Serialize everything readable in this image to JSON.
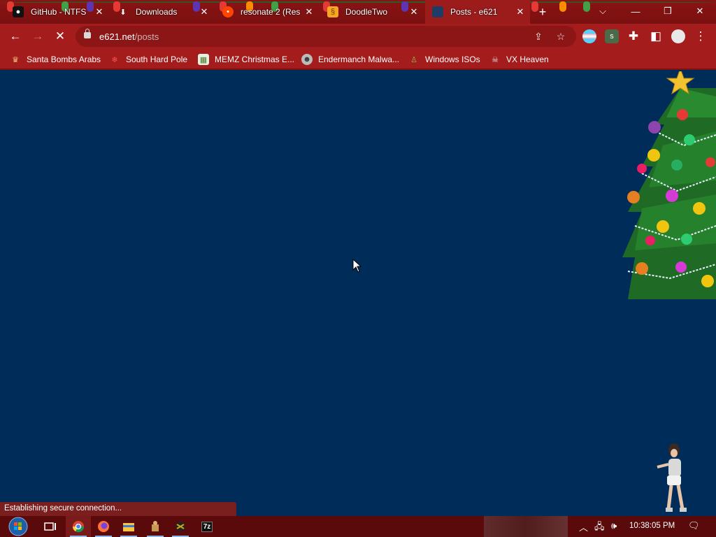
{
  "tabs": [
    {
      "label": "GitHub - NTFS",
      "icon": "github-icon",
      "color": "#111111",
      "active": false
    },
    {
      "label": "Downloads",
      "icon": "download-icon",
      "color": "#ffffff",
      "active": false
    },
    {
      "label": "resonate 2 (Res",
      "icon": "reddit-icon",
      "color": "#ff4500",
      "active": false
    },
    {
      "label": "DoodleTwo",
      "icon": "doodle-icon",
      "color": "#f5a623",
      "active": false
    },
    {
      "label": "Posts - e621",
      "icon": "e621-icon",
      "color": "#1f3c67",
      "active": true
    }
  ],
  "window_controls": {
    "dropdown": "⌵",
    "minimize": "—",
    "restore": "❐",
    "close": "✕"
  },
  "toolbar": {
    "url_host": "e621.net",
    "url_path": "/posts"
  },
  "bookmarks": [
    {
      "label": "Santa Bombs Arabs",
      "icon": "santa-icon",
      "color": "#c0392b"
    },
    {
      "label": "South Hard Pole",
      "icon": "snowflake-icon",
      "color": "#d0312d"
    },
    {
      "label": "MEMZ Christmas E...",
      "icon": "memz-icon",
      "color": "#9bbf5a"
    },
    {
      "label": "Endermanch Malwa...",
      "icon": "endermanch-icon",
      "color": "#6a6a6a"
    },
    {
      "label": "Windows ISOs",
      "icon": "windows-isos-icon",
      "color": "#5e8a2c"
    },
    {
      "label": "VX Heaven",
      "icon": "vx-heaven-icon",
      "color": "#cfcfcf"
    }
  ],
  "status": {
    "text": "Establishing secure connection..."
  },
  "taskbar": {
    "apps": [
      "chrome-icon",
      "firefox-icon",
      "file-explorer-icon",
      "installer-icon",
      "hacker-icon",
      "7zip-icon"
    ],
    "seven_zip_label": "7z",
    "clock": "10:38:05 PM"
  },
  "colors": {
    "titlebar": "#7a1010",
    "toolbar": "#a51c1c",
    "content_background": "#002c5a",
    "taskbar": "#5a0a0a"
  }
}
